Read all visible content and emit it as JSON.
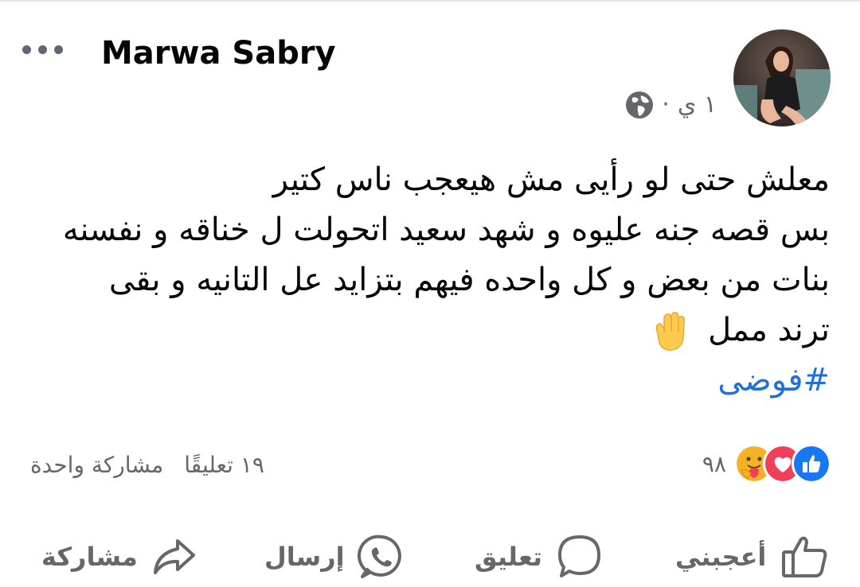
{
  "post": {
    "author_name": "Marwa Sabry",
    "timestamp": "١ ي",
    "separator": "·",
    "privacy_icon": "globe-icon",
    "text_lines": [
      "معلش حتى لو رأيى مش هيعجب ناس كتير",
      "بس قصه جنه عليوه و شهد سعيد اتحولت ل خناقه و نفسنه",
      "بنات من بعض و كل واحده فيهم بتزايد عل التانيه و بقى",
      "ترند ممل"
    ],
    "trailing_emoji": "raised-hand-emoji",
    "hashtag": "#فوضى"
  },
  "reactions": {
    "icons": [
      "like-reaction-icon",
      "love-reaction-icon",
      "care-reaction-icon"
    ],
    "count": "٩٨"
  },
  "counts": {
    "comments": "١٩ تعليقًا",
    "shares": "مشاركة واحدة"
  },
  "actions": {
    "like_label": "أعجبني",
    "comment_label": "تعليق",
    "send_label": "إرسال",
    "share_label": "مشاركة"
  },
  "colors": {
    "link": "#216fdb",
    "muted": "#65676b",
    "like_blue": "#1877f2",
    "love_red": "#f33e58"
  }
}
